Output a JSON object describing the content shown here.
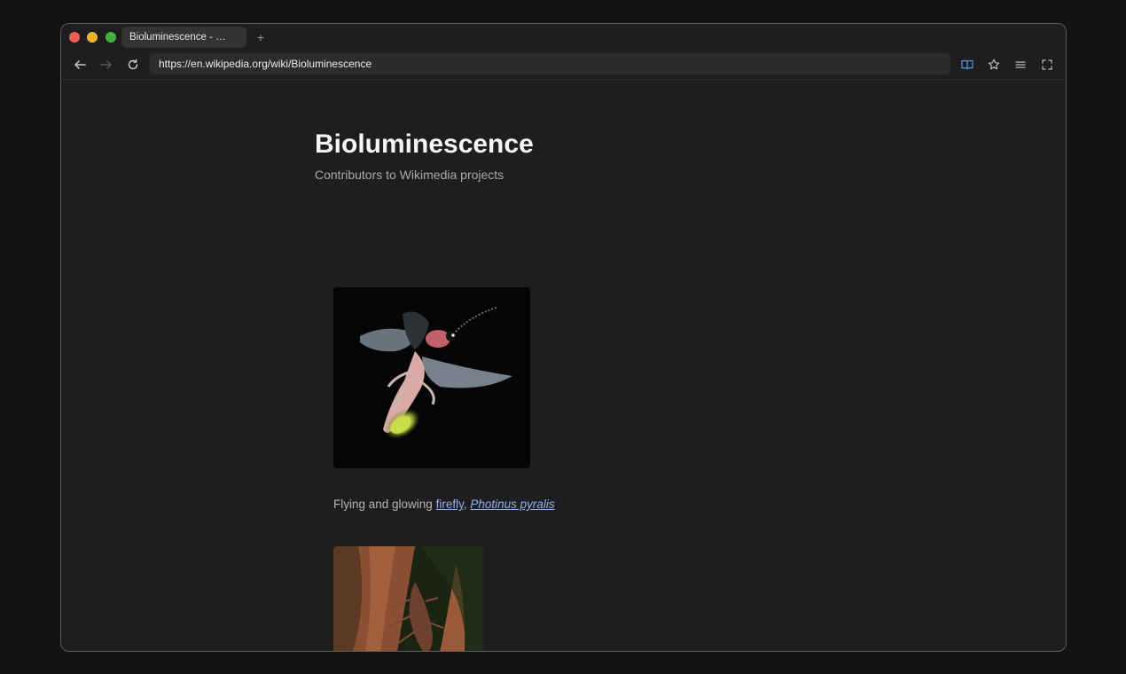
{
  "browser": {
    "tab_title": "Bioluminescence - …",
    "new_tab_label": "+",
    "url": "https://en.wikipedia.org/wiki/Bioluminescence"
  },
  "icons": {
    "back": "arrow-left-icon",
    "forward": "arrow-right-icon",
    "reload": "reload-icon",
    "reader": "book-icon",
    "bookmark": "star-icon",
    "menu": "hamburger-icon",
    "fullscreen": "fullscreen-icon"
  },
  "article": {
    "title": "Bioluminescence",
    "subtitle": "Contributors to Wikimedia projects",
    "figure1": {
      "caption_prefix": "Flying and glowing ",
      "link1": "firefly",
      "separator": ", ",
      "link2": "Photinus pyralis"
    }
  },
  "colors": {
    "background": "#1e1e20",
    "link": "#8fb2f0",
    "accent_icon": "#5f8fe6"
  }
}
